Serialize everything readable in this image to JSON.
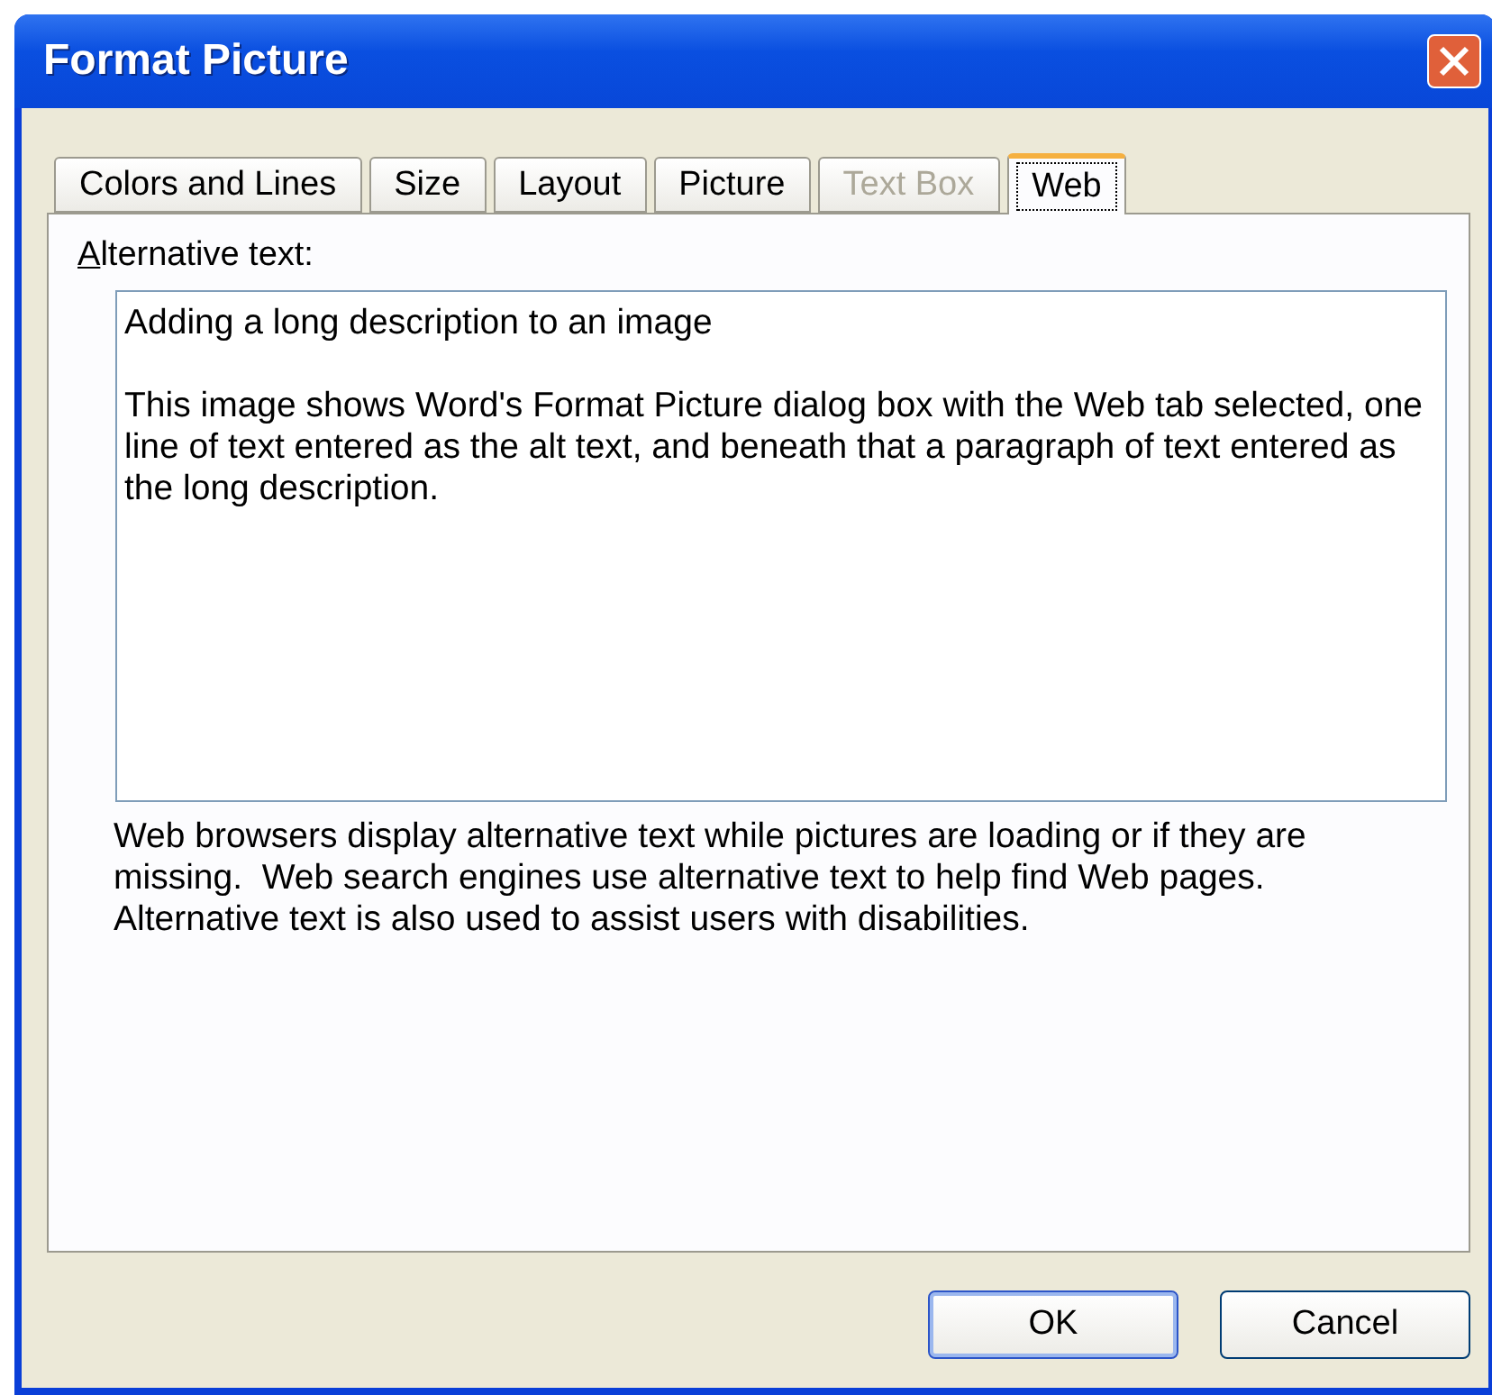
{
  "window": {
    "title": "Format Picture"
  },
  "tabs": [
    {
      "label": "Colors and Lines",
      "selected": false,
      "disabled": false
    },
    {
      "label": "Size",
      "selected": false,
      "disabled": false
    },
    {
      "label": "Layout",
      "selected": false,
      "disabled": false
    },
    {
      "label": "Picture",
      "selected": false,
      "disabled": false
    },
    {
      "label": "Text Box",
      "selected": false,
      "disabled": true
    },
    {
      "label": "Web",
      "selected": true,
      "disabled": false
    }
  ],
  "alternative_text": {
    "label": "Alternative text:",
    "value": "Adding a long description to an image\n\nThis image shows Word's Format Picture dialog box with the Web tab selected, one line of text entered as the alt text, and beneath that a paragraph of text entered as the long description."
  },
  "hint": "Web browsers display alternative text while pictures are loading or if they are missing.  Web search engines use alternative text to help find Web pages.  Alternative text is also used to assist users with disabilities.",
  "buttons": [
    {
      "label": "OK",
      "default": true
    },
    {
      "label": "Cancel",
      "default": false
    }
  ]
}
